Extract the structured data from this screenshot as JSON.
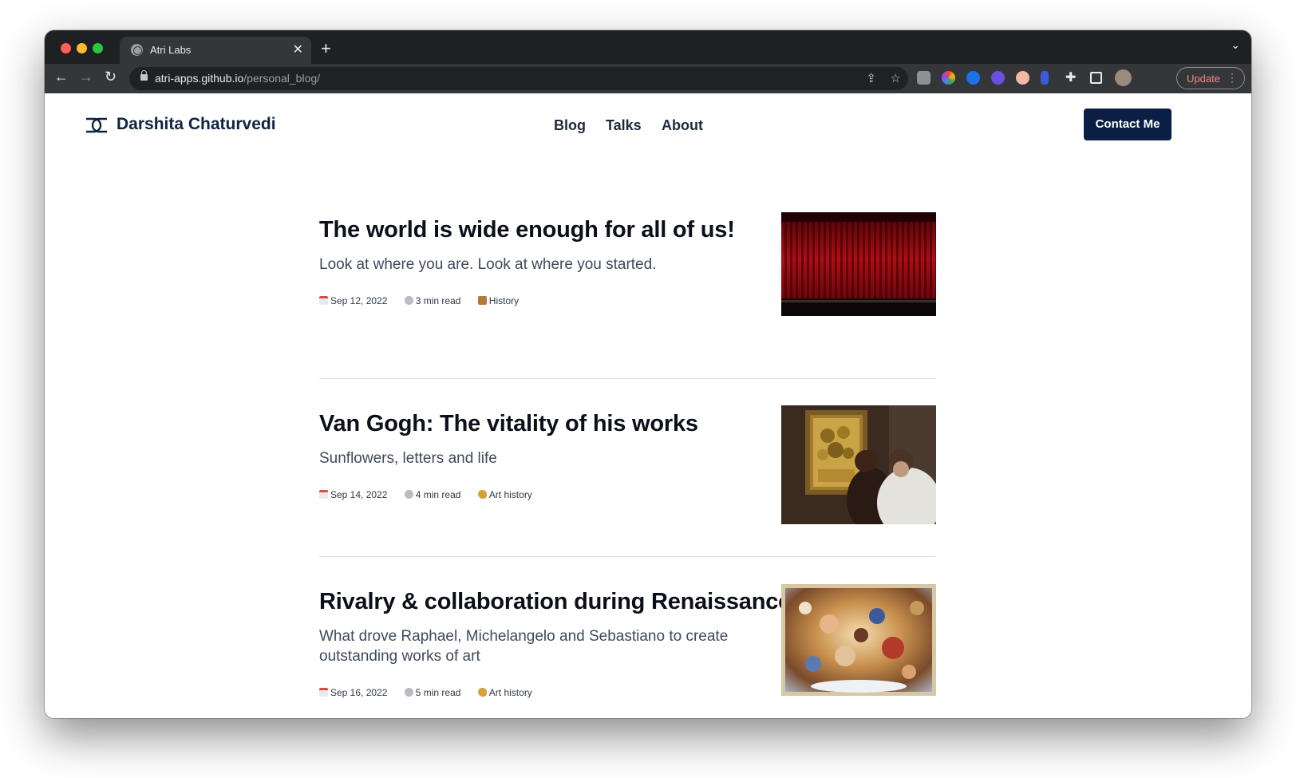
{
  "browser": {
    "tab_title": "Atri Labs",
    "url_host": "atri-apps.github.io",
    "url_path": "/personal_blog/",
    "update_label": "Update"
  },
  "site": {
    "brand": "Darshita Chaturvedi",
    "nav": [
      "Blog",
      "Talks",
      "About"
    ],
    "contact_label": "Contact Me"
  },
  "posts": [
    {
      "title": "The world is wide enough for all of us!",
      "subtitle": "Look at where you are. Look at where you started.",
      "date": "Sep 12, 2022",
      "read_time": "3 min read",
      "category": "History",
      "category_icon": "scroll-icon",
      "image": "red-theater-curtain"
    },
    {
      "title": "Van Gogh: The vitality of his works",
      "subtitle": "Sunflowers, letters and life",
      "date": "Sep 14, 2022",
      "read_time": "4 min read",
      "category": "Art history",
      "category_icon": "palette-icon",
      "image": "sunflowers-painting-viewers"
    },
    {
      "title": "Rivalry & collaboration during Renaissance",
      "subtitle": "What drove Raphael, Michelangelo and Sebastiano to create outstanding works of art",
      "date": "Sep 16, 2022",
      "read_time": "5 min read",
      "category": "Art history",
      "category_icon": "palette-icon",
      "image": "baroque-ceiling-fresco"
    }
  ]
}
